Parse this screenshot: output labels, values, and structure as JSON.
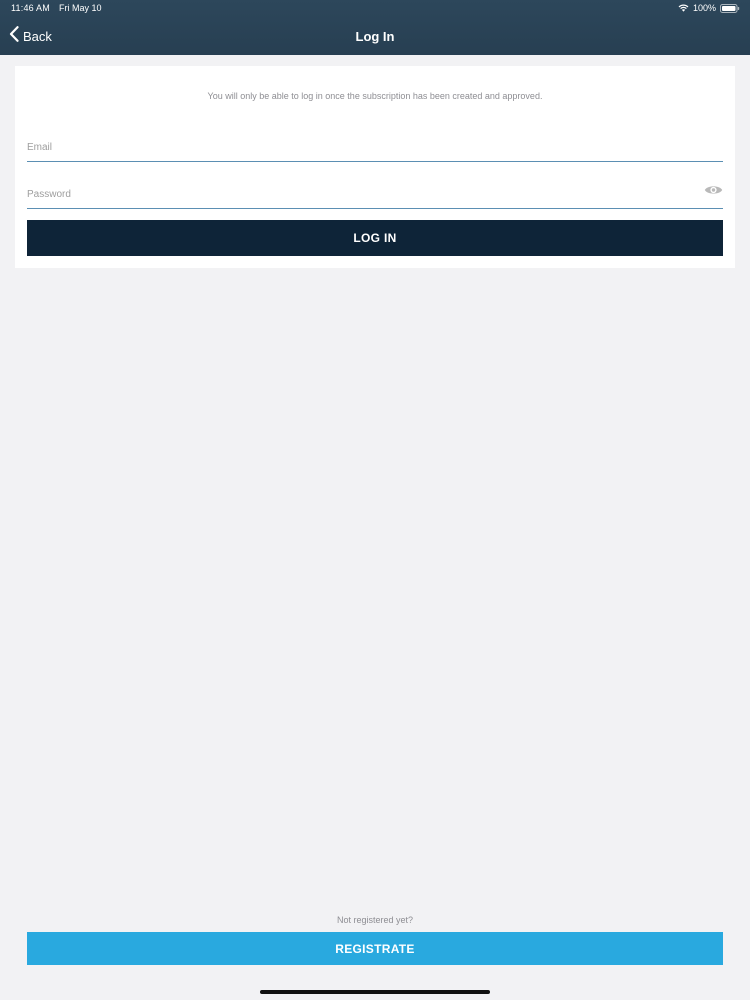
{
  "status_bar": {
    "time": "11:46 AM",
    "date": "Fri May 10",
    "battery": "100%"
  },
  "nav": {
    "back_label": "Back",
    "title": "Log In",
    "back_icon": "chevron-left-icon"
  },
  "login_card": {
    "notice": "You will only be able to log in once the subscription has been created and approved.",
    "email_placeholder": "Email",
    "email_value": "",
    "password_placeholder": "Password",
    "password_value": "",
    "password_toggle_icon": "eye-icon",
    "login_label": "LOG IN"
  },
  "footer": {
    "prompt": "Not registered yet?",
    "register_label": "REGISTRATE"
  },
  "colors": {
    "nav_background": "#2b4558",
    "login_button": "#0e2438",
    "register_button": "#29a9df",
    "field_underline": "#5b8fb3"
  }
}
